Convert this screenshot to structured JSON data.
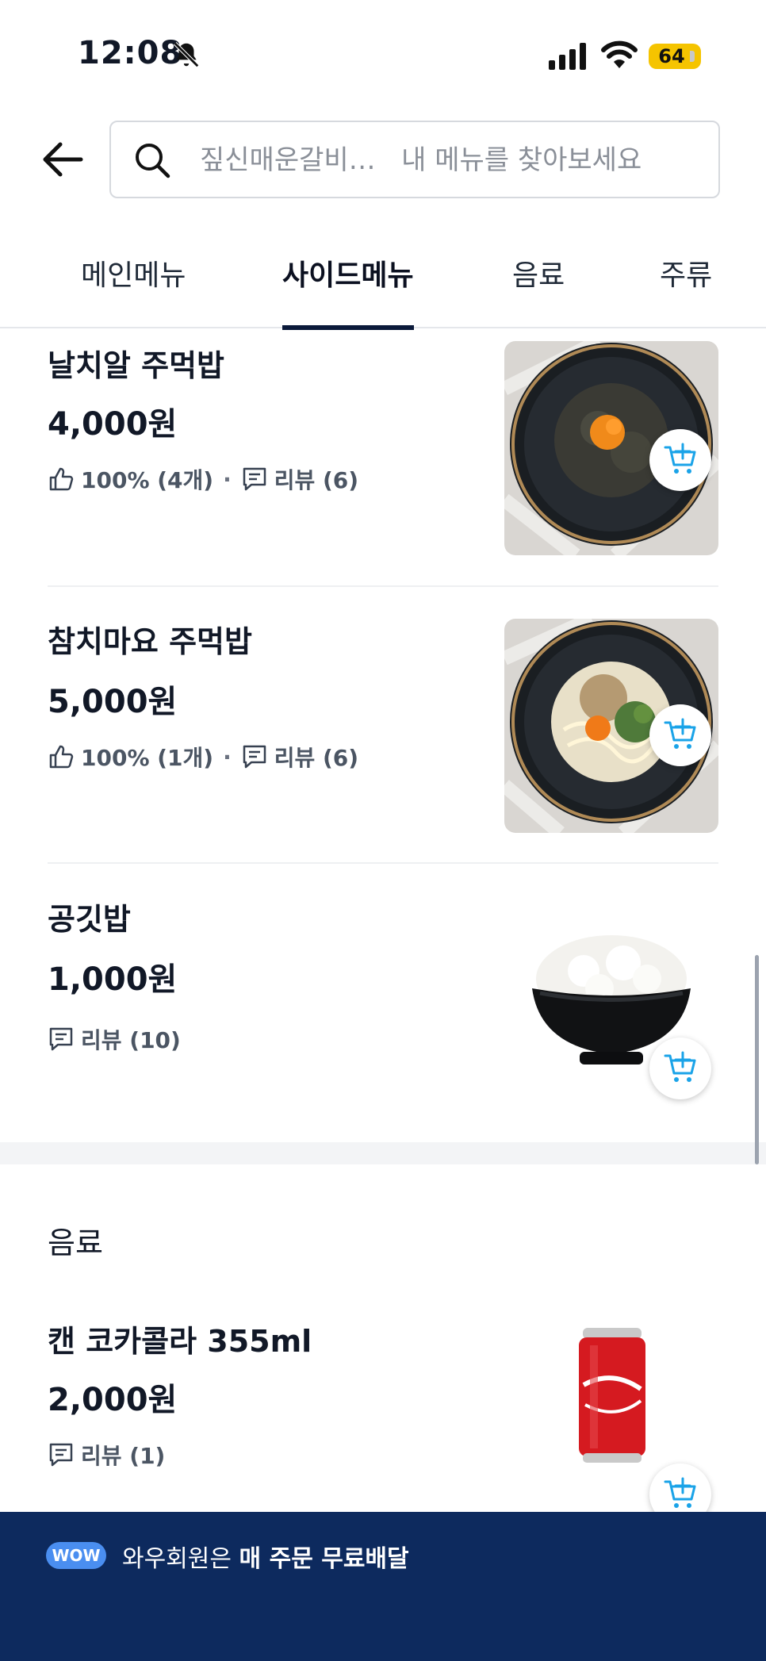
{
  "status_bar": {
    "time": "12:08",
    "battery": "64"
  },
  "search": {
    "placeholder": "짚신매운갈비…   내 메뉴를 찾아보세요"
  },
  "tabs": [
    {
      "label": "메인메뉴",
      "active": false
    },
    {
      "label": "사이드메뉴",
      "active": true
    },
    {
      "label": "음료",
      "active": false
    },
    {
      "label": "주류",
      "active": false
    }
  ],
  "items": [
    {
      "name": "날치알 주먹밥",
      "price": "4,000원",
      "like": "100% (4개)",
      "review": "리뷰 (6)"
    },
    {
      "name": " 참치마요 주먹밥",
      "price": "5,000원",
      "like": "100% (1개)",
      "review": "리뷰 (6)"
    },
    {
      "name": "공깃밥",
      "price": "1,000원",
      "review": "리뷰 (10)"
    }
  ],
  "section": {
    "title": "음료"
  },
  "drink_item": {
    "name": "캔 코카콜라 355ml",
    "price": "2,000원",
    "review": "리뷰 (1)"
  },
  "banner": {
    "badge": "WOW",
    "text_normal": "와우회원은 ",
    "text_bold": "매 주문 무료배달"
  },
  "colors": {
    "accent": "#0d2a5e",
    "cart_icon": "#1aa3e8",
    "tab_underline": "#0b1a3a",
    "battery": "#f5c400"
  }
}
